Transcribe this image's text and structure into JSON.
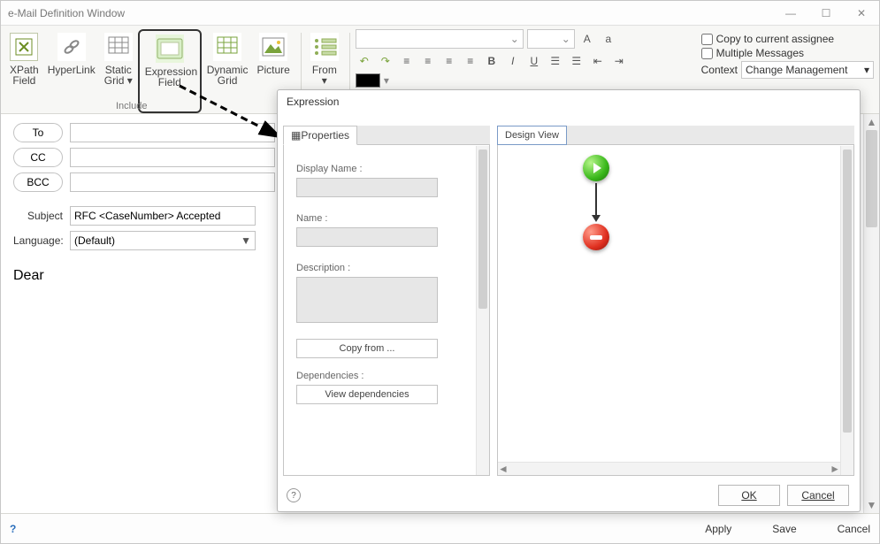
{
  "window": {
    "title": "e-Mail Definition Window"
  },
  "ribbon": {
    "xpath": "XPath\nField",
    "hyperlink": "HyperLink",
    "staticgrid": "Static\nGrid",
    "exprfield": "Expression\nField",
    "dyngrid": "Dynamic\nGrid",
    "picture": "Picture",
    "from": "From",
    "group_include": "Include",
    "group_from": "From"
  },
  "options": {
    "copy_assignee": "Copy to current assignee",
    "multi_msg": "Multiple Messages",
    "context_label": "Context",
    "context_value": "Change Management"
  },
  "form": {
    "to": "To",
    "cc": "CC",
    "bcc": "BCC",
    "subject_label": "Subject",
    "subject_value": "RFC <CaseNumber> Accepted",
    "language_label": "Language:",
    "language_value": "(Default)",
    "body": "Dear"
  },
  "dialog": {
    "title": "Expression",
    "tab_props": "Properties",
    "tab_design": "Design View",
    "display_name": "Display Name :",
    "name": "Name :",
    "description": "Description :",
    "copy_from": "Copy from ...",
    "dependencies": "Dependencies :",
    "view_deps": "View dependencies",
    "ok": "OK",
    "cancel": "Cancel"
  },
  "footer": {
    "apply": "Apply",
    "save": "Save",
    "cancel": "Cancel"
  }
}
